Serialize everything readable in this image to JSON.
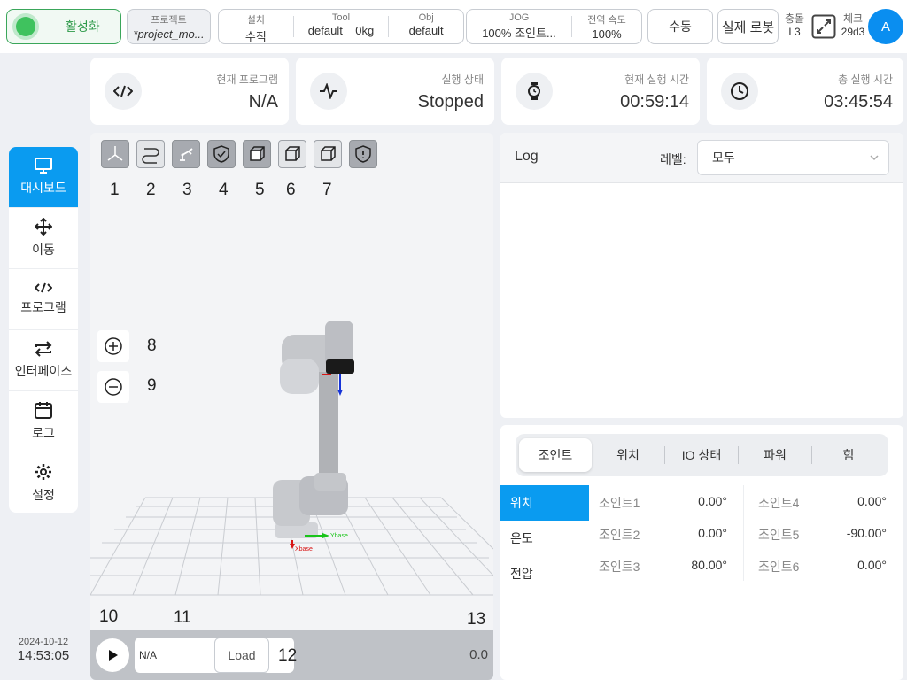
{
  "topbar": {
    "activate_label": "활성화",
    "project_title": "프로젝트",
    "project_value": "*project_mo...",
    "install": [
      {
        "title": "설치",
        "value": "수직"
      },
      {
        "title": "Tool",
        "value": "default    0kg"
      },
      {
        "title": "Obj",
        "value": "default"
      }
    ],
    "jog": [
      {
        "title": "JOG",
        "value": "100%  조인트..."
      },
      {
        "title": "전역 속도",
        "value": "100%"
      }
    ],
    "manual_label": "수동",
    "realrobot_label": "실제 로봇",
    "collision_title": "충돌",
    "collision_value": "L3",
    "check_title": "체크",
    "check_value": "29d3",
    "avatar_letter": "A"
  },
  "cards": [
    {
      "title": "현재 프로그램",
      "value": "N/A",
      "icon": "code-icon"
    },
    {
      "title": "실행 상태",
      "value": "Stopped",
      "icon": "pulse-icon"
    },
    {
      "title": "현재 실행 시간",
      "value": "00:59:14",
      "icon": "stopwatch-icon"
    },
    {
      "title": "총 실행 시간",
      "value": "03:45:54",
      "icon": "clock-icon"
    }
  ],
  "nav": [
    {
      "label": "대시보드",
      "icon": "monitor-icon",
      "active": true
    },
    {
      "label": "이동",
      "icon": "move-icon"
    },
    {
      "label": "프로그램",
      "icon": "code-icon"
    },
    {
      "label": "인터페이스",
      "icon": "swap-icon"
    },
    {
      "label": "로그",
      "icon": "calendar-icon"
    },
    {
      "label": "설정",
      "icon": "gear-icon"
    }
  ],
  "datetime": {
    "date": "2024-10-12",
    "time": "14:53:05"
  },
  "viewport": {
    "tool_numbers": [
      "1",
      "2",
      "3",
      "4",
      "5",
      "6",
      "7"
    ],
    "zoom_in_number": "8",
    "zoom_out_number": "9",
    "label_10": "10",
    "label_11": "11",
    "label_12": "12",
    "label_13": "13",
    "program_field": "N/A",
    "load_label": "Load",
    "speed_value": "0.0",
    "axis_x": "Xbase",
    "axis_y": "Ybase"
  },
  "log": {
    "title": "Log",
    "level_label": "레벨:",
    "level_value": "모두"
  },
  "data_panel": {
    "tabs": [
      "조인트",
      "위치",
      "IO 상태",
      "파워",
      "힘"
    ],
    "subtabs": [
      "위치",
      "온도",
      "전압"
    ],
    "joints_left": [
      {
        "name": "조인트1",
        "value": "0.00°"
      },
      {
        "name": "조인트2",
        "value": "0.00°"
      },
      {
        "name": "조인트3",
        "value": "80.00°"
      }
    ],
    "joints_right": [
      {
        "name": "조인트4",
        "value": "0.00°"
      },
      {
        "name": "조인트5",
        "value": "-90.00°"
      },
      {
        "name": "조인트6",
        "value": "0.00°"
      }
    ]
  },
  "colors": {
    "accent": "#0a9bf0",
    "active_green": "#3fc25e"
  }
}
